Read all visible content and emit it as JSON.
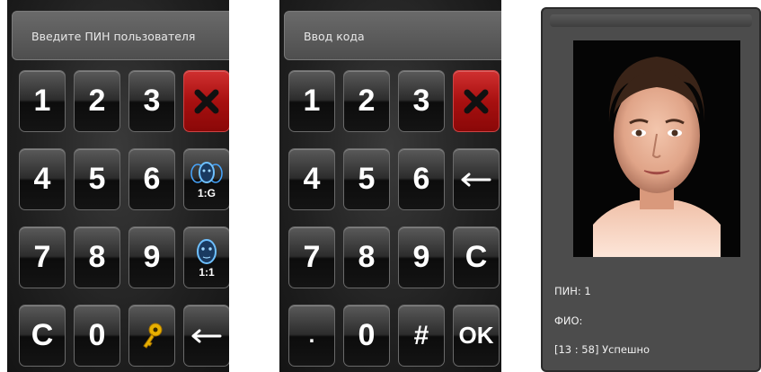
{
  "pin_screen": {
    "header": "Введите ПИН пользователя",
    "keys": [
      "1",
      "2",
      "3",
      "4",
      "5",
      "6",
      "7",
      "8",
      "9",
      "C",
      "0"
    ],
    "verify_group_label": "1:G",
    "verify_one_label": "1:1",
    "icons": {
      "delete": "x-icon",
      "group_verify": "faces-icon",
      "one_verify": "face-icon",
      "key": "key-icon",
      "backspace": "back-arrow-icon"
    }
  },
  "code_screen": {
    "header": "Ввод кода",
    "keys": [
      "1",
      "2",
      "3",
      "4",
      "5",
      "6",
      "7",
      "8",
      "9",
      "C",
      ".",
      "0",
      "#",
      "OK"
    ],
    "icons": {
      "delete": "x-icon",
      "backspace": "back-arrow-icon"
    }
  },
  "result_screen": {
    "pin_label": "ПИН: 1",
    "name_label": "ФИО:",
    "status": "[13 : 58] Успешно",
    "photo": "user-photo"
  },
  "colors": {
    "accent_red": "#b01515",
    "face_blue": "#46a6ff",
    "key_gold": "#e8b000"
  }
}
